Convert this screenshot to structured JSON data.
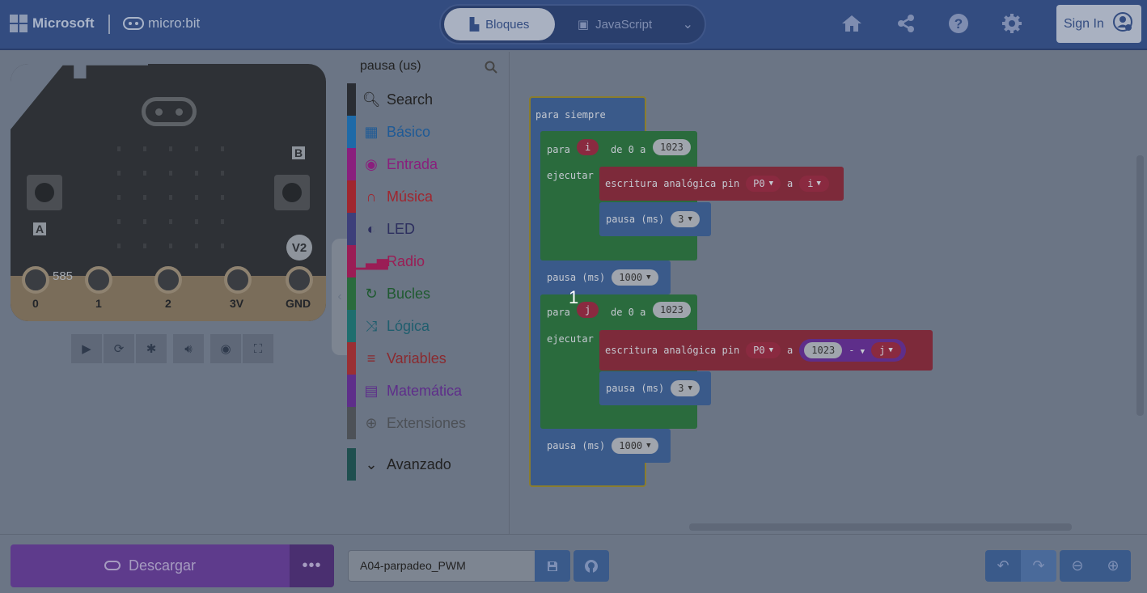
{
  "header": {
    "brand": "Microsoft",
    "product": "micro:bit",
    "modes": {
      "blocks": "Bloques",
      "javascript": "JavaScript"
    },
    "signin": "Sign In",
    "icons": [
      "home-icon",
      "share-icon",
      "help-icon",
      "settings-icon"
    ]
  },
  "simulator": {
    "button_a": "A",
    "button_b": "B",
    "version": "V2",
    "light_value": "585",
    "pins": [
      "0",
      "1",
      "2",
      "3V",
      "GND"
    ]
  },
  "toolbox": {
    "search_value": "pausa (us)",
    "categories": [
      {
        "label": "Search",
        "color": "#2a2d33",
        "text_color": "#222222",
        "icon": "search-icon"
      },
      {
        "label": "Básico",
        "color": "#1e6aa8",
        "text_color": "#1e5a96",
        "icon": "grid-icon"
      },
      {
        "label": "Entrada",
        "color": "#8a1f7d",
        "text_color": "#8a1f7d",
        "icon": "input-icon"
      },
      {
        "label": "Música",
        "color": "#a0262f",
        "text_color": "#a0262f",
        "icon": "headphones-icon"
      },
      {
        "label": "LED",
        "color": "#3d3f7a",
        "text_color": "#2d2f5f",
        "icon": "toggle-icon"
      },
      {
        "label": "Radio",
        "color": "#9a1d55",
        "text_color": "#9a1d55",
        "icon": "signal-icon"
      },
      {
        "label": "Bucles",
        "color": "#2a6b3d",
        "text_color": "#1f5a30",
        "icon": "loop-icon"
      },
      {
        "label": "Lógica",
        "color": "#1f6e6e",
        "text_color": "#1f5e6e",
        "icon": "logic-icon"
      },
      {
        "label": "Variables",
        "color": "#9a2f33",
        "text_color": "#8a2a2f",
        "icon": "variables-icon"
      },
      {
        "label": "Matemática",
        "color": "#5e2e8a",
        "text_color": "#5e2e8a",
        "icon": "calculator-icon"
      },
      {
        "label": "Extensiones",
        "color": "#4d5157",
        "text_color": "#4d5157",
        "icon": "plus-circle-icon"
      },
      {
        "label": "Avanzado",
        "color": "#1f4f4f",
        "text_color": "#222222",
        "icon": "chevron-down-icon"
      }
    ]
  },
  "workspace": {
    "forever_label": "para siempre",
    "loop1": {
      "para": "para",
      "var": "i",
      "range": "de 0 a",
      "max": "1023",
      "ejecutar": "ejecutar"
    },
    "analog1": {
      "label": "escritura analógica pin",
      "pin": "P0",
      "a": "a",
      "value": "i"
    },
    "pause_inner1": {
      "label": "pausa (ms)",
      "value": "3"
    },
    "pause_outer1": {
      "label": "pausa (ms)",
      "value": "1000"
    },
    "loop2": {
      "para": "para",
      "var": "j",
      "range": "de 0 a",
      "max": "1023",
      "ejecutar": "ejecutar"
    },
    "analog2": {
      "label": "escritura analógica pin",
      "pin": "P0",
      "a": "a",
      "left": "1023",
      "op": "-",
      "right": "j"
    },
    "pause_inner2": {
      "label": "pausa (ms)",
      "value": "3"
    },
    "pause_outer2": {
      "label": "pausa (ms)",
      "value": "1000"
    },
    "cursor_number": "1"
  },
  "footer": {
    "download": "Descargar",
    "project_name": "A04-parpadeo_PWM"
  }
}
